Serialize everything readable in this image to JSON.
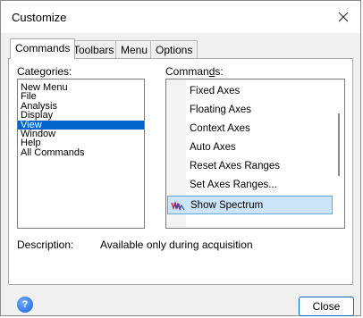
{
  "window": {
    "title": "Customize"
  },
  "tabs": [
    {
      "label": "Commands",
      "active": true
    },
    {
      "label": "Toolbars",
      "active": false
    },
    {
      "label": "Menu",
      "active": false
    },
    {
      "label": "Options",
      "active": false
    }
  ],
  "categories": {
    "label": "Categories:",
    "items": [
      "New Menu",
      "File",
      "Analysis",
      "Display",
      "View",
      "Window",
      "Help",
      "All Commands"
    ],
    "selected": "View"
  },
  "commands": {
    "label": "Commands:",
    "items": [
      {
        "label": "Fixed Axes",
        "icon": ""
      },
      {
        "label": "Floating Axes",
        "icon": ""
      },
      {
        "label": "Context Axes",
        "icon": ""
      },
      {
        "label": "Auto Axes",
        "icon": ""
      },
      {
        "label": "Reset Axes Ranges",
        "icon": ""
      },
      {
        "label": "Set Axes Ranges...",
        "icon": ""
      },
      {
        "label": "Show Spectrum",
        "icon": "spectrum-icon"
      }
    ],
    "selected": "Show Spectrum"
  },
  "description": {
    "label": "Description:",
    "text": "Available only during acquisition"
  },
  "buttons": {
    "close": "Close",
    "help": "?"
  },
  "colors": {
    "selection": "#0066cc",
    "command_highlight": "#cce4f7",
    "accent": "#0067c0"
  }
}
